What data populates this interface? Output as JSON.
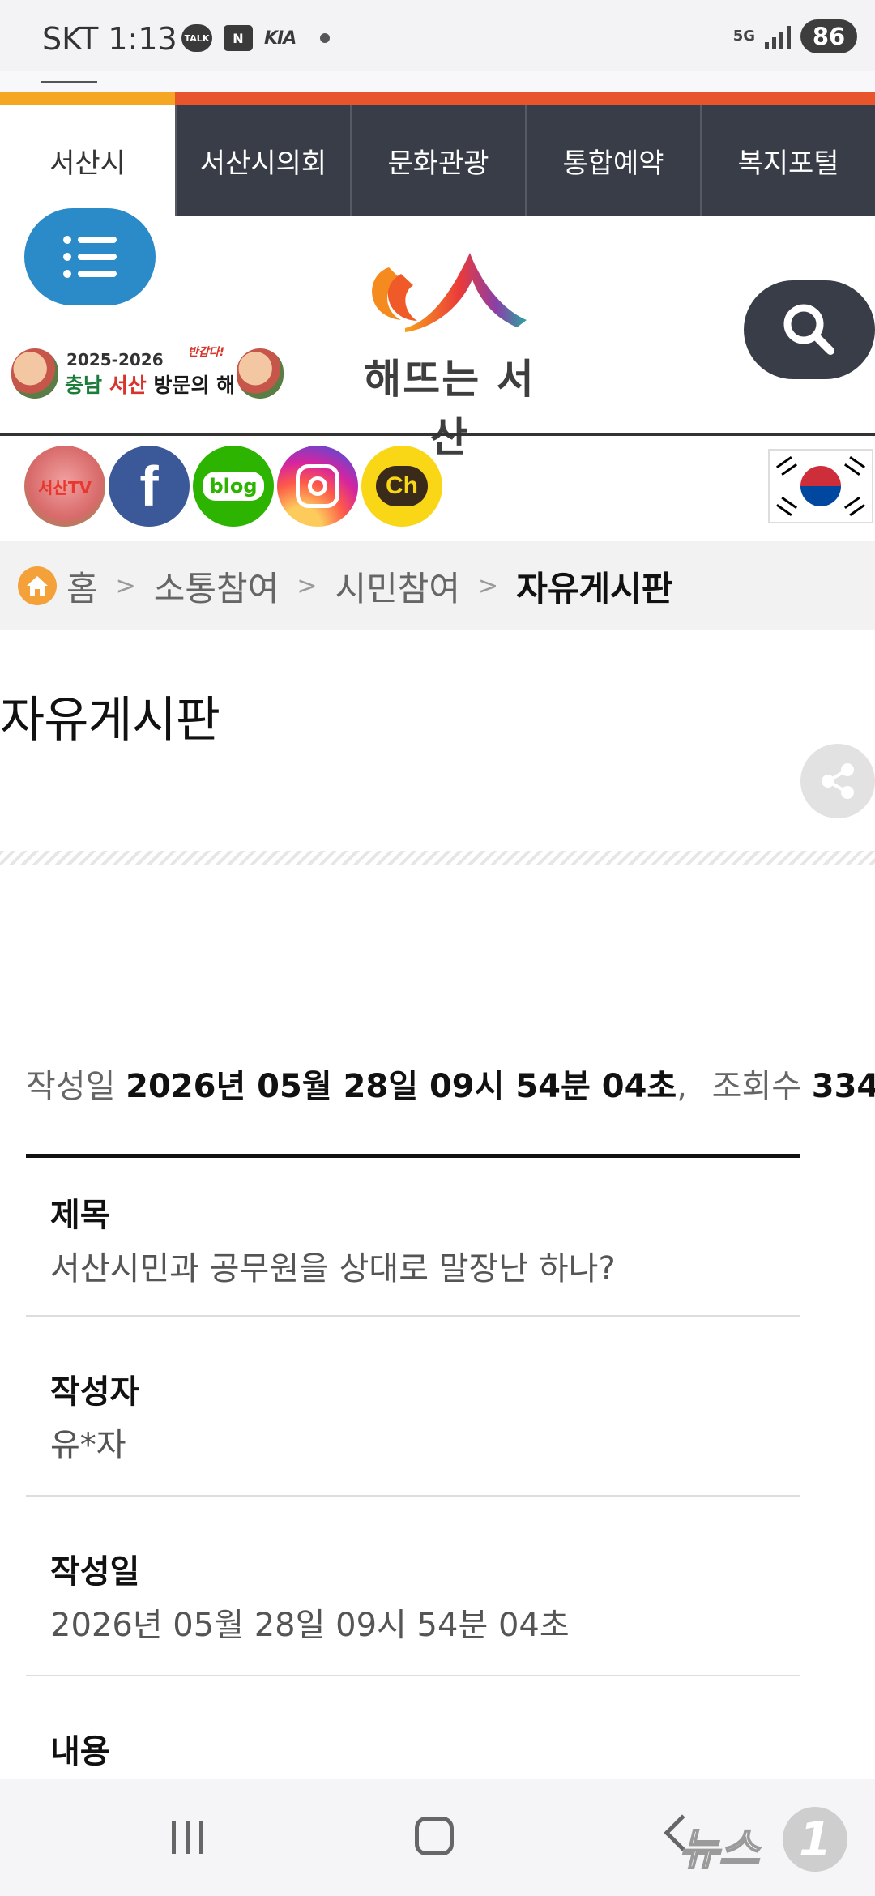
{
  "status_bar": {
    "carrier_time": "SKT 1:13",
    "talk_badge": "TALK",
    "bag_badge": "N",
    "brand_text": "KIA",
    "network": "5G",
    "battery": "86"
  },
  "site_tabs": [
    {
      "label": "서산시",
      "active": true
    },
    {
      "label": "서산시의회",
      "active": false
    },
    {
      "label": "문화관광",
      "active": false
    },
    {
      "label": "통합예약",
      "active": false
    },
    {
      "label": "복지포털",
      "active": false
    }
  ],
  "header": {
    "menu_icon": "menu-list-icon",
    "banner": {
      "years": "2025-2026",
      "line_green": "충남",
      "line_red": "서산",
      "line_black": "방문의 해",
      "slogan": "반갑다!"
    },
    "logo_text": "해뜨는 서산",
    "search_icon": "search-icon"
  },
  "social": {
    "items": [
      {
        "name": "seosan-tv",
        "label": "서산TV"
      },
      {
        "name": "facebook",
        "label": "f"
      },
      {
        "name": "blog",
        "label": "blog"
      },
      {
        "name": "instagram",
        "label": ""
      },
      {
        "name": "kakao-channel",
        "label": "Ch"
      }
    ]
  },
  "breadcrumb": {
    "items": [
      "홈",
      "소통참여",
      "시민참여",
      "자유게시판"
    ]
  },
  "page": {
    "title": "자유게시판"
  },
  "post": {
    "meta_date_label": "작성일",
    "meta_date_value": "2026년 05월 28일 09시 54분 04초",
    "meta_sep": ",",
    "meta_views_label": "조회수",
    "meta_views_value": "334",
    "fields": [
      {
        "label": "제목",
        "value": "서산시민과 공무원을 상대로 말장난 하나?"
      },
      {
        "label": "작성자",
        "value": "유*자"
      },
      {
        "label": "작성일",
        "value": "2026년 05월 28일 09시 54분 04초"
      },
      {
        "label": "내용",
        "value": ""
      }
    ]
  },
  "watermark": {
    "text": "뉴스",
    "number": "1"
  },
  "colors": {
    "accent_orange": "#f5a623",
    "accent_red": "#e8542b",
    "tab_dark": "#383d47",
    "menu_blue": "#2b8ac8"
  }
}
